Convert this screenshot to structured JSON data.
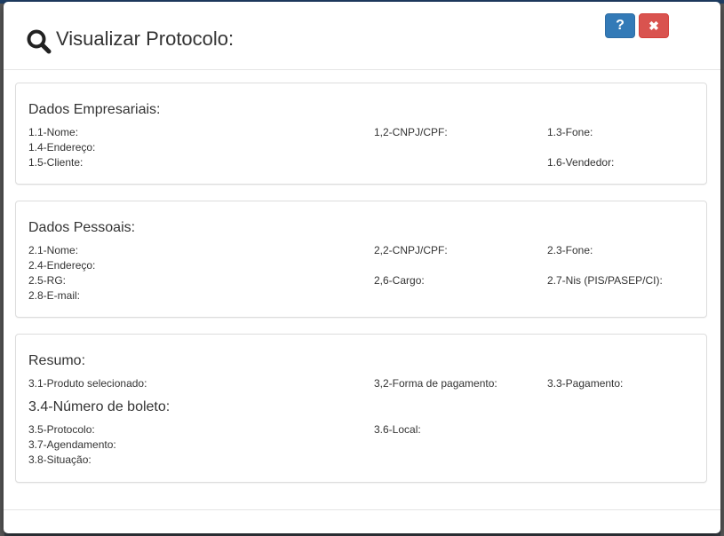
{
  "modal": {
    "title": "Visualizar Protocolo:",
    "help_label": "?",
    "close_label": "✖"
  },
  "empresa": {
    "title": "Dados Empresariais:",
    "nome": "1.1-Nome:",
    "cnpj": "1,2-CNPJ/CPF:",
    "fone": "1.3-Fone:",
    "endereco": "1.4-Endereço:",
    "cliente": "1.5-Cliente:",
    "vendedor": "1.6-Vendedor:"
  },
  "pessoal": {
    "title": "Dados Pessoais:",
    "nome": "2.1-Nome:",
    "cnpj": "2,2-CNPJ/CPF:",
    "fone": "2.3-Fone:",
    "endereco": "2.4-Endereço:",
    "rg": "2.5-RG:",
    "cargo": "2,6-Cargo:",
    "nis": "2.7-Nis (PIS/PASEP/CI):",
    "email": "2.8-E-mail:"
  },
  "resumo": {
    "title": "Resumo:",
    "produto": "3.1-Produto selecionado:",
    "forma_pagamento": "3,2-Forma de pagamento:",
    "pagamento": "3.3-Pagamento:",
    "boleto": "3.4-Número de boleto:",
    "protocolo": "3.5-Protocolo:",
    "local": "3.6-Local:",
    "agendamento": "3.7-Agendamento:",
    "situacao": "3.8-Situação:"
  },
  "colors": {
    "primary": "#337ab7",
    "danger": "#d9534f",
    "border": "#dddddd"
  },
  "icons": {
    "title": "search-icon",
    "close": "close-icon"
  }
}
